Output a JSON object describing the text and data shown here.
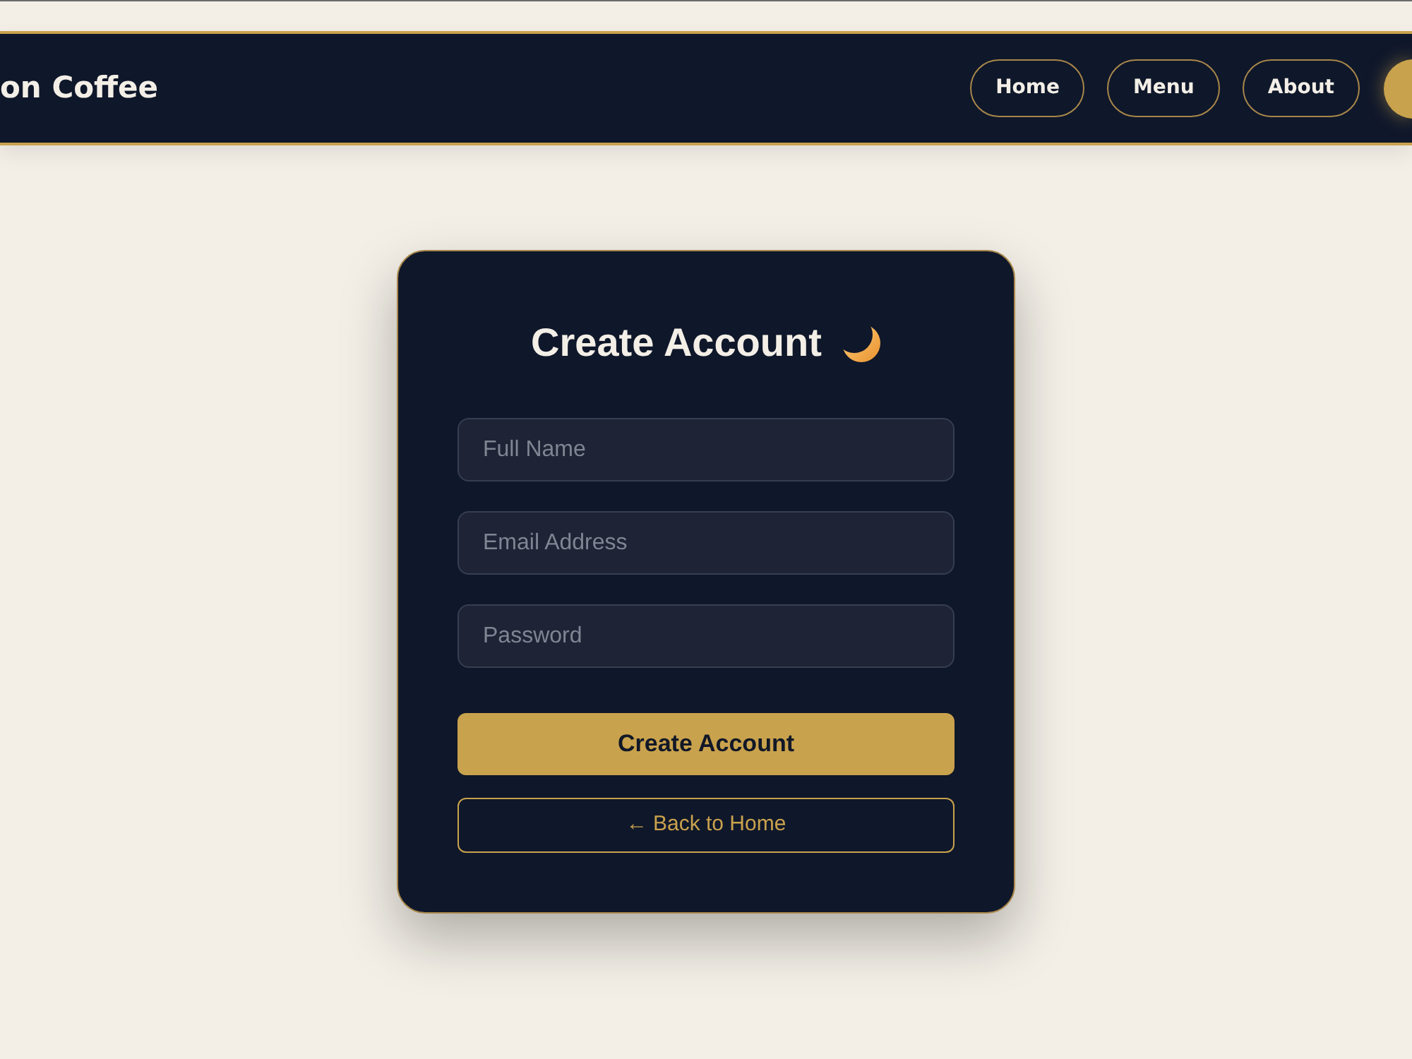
{
  "navbar": {
    "brand": "on Coffee",
    "links": [
      {
        "label": "Home"
      },
      {
        "label": "Menu"
      },
      {
        "label": "About"
      }
    ]
  },
  "signup_card": {
    "title": "Create Account",
    "fields": [
      {
        "placeholder": "Full Name"
      },
      {
        "placeholder": "Email Address"
      },
      {
        "placeholder": "Password"
      }
    ],
    "submit_button": "Create Account",
    "back_link": "← Back to Home"
  }
}
